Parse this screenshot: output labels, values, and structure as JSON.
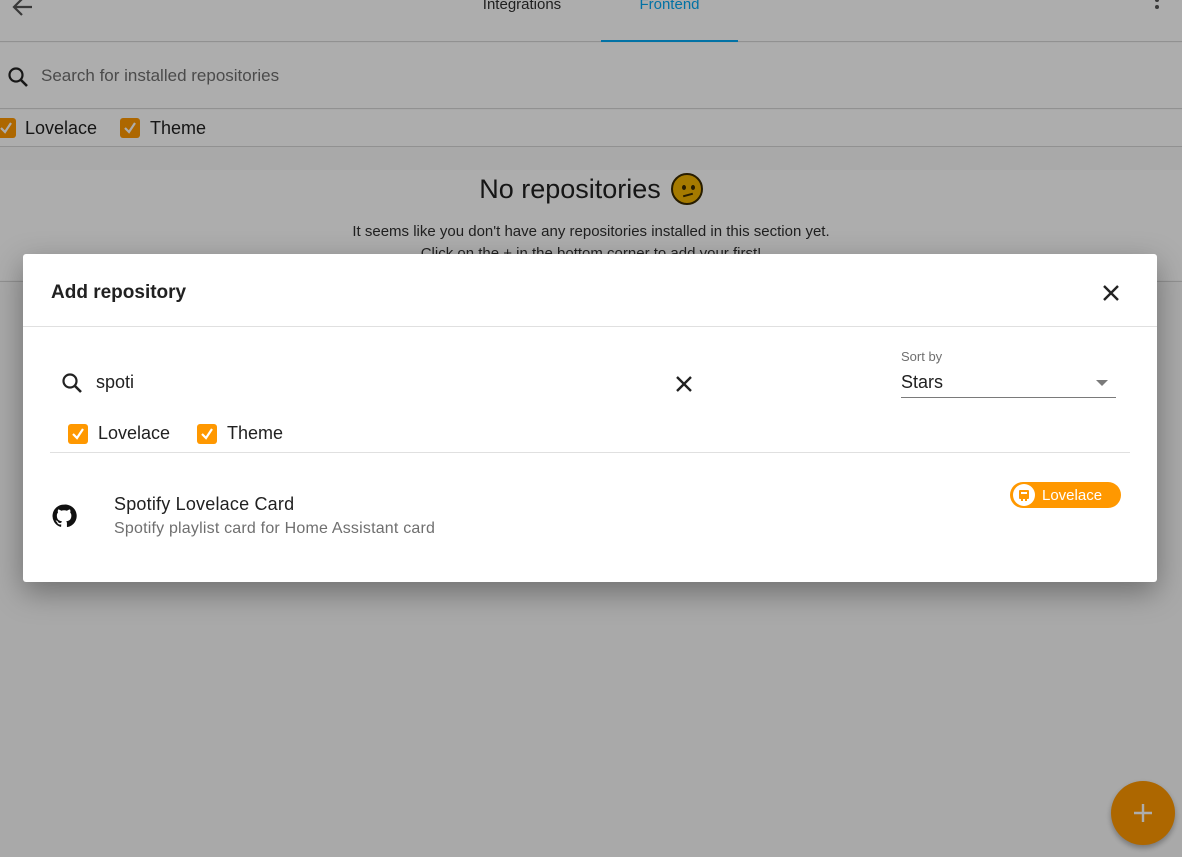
{
  "header": {
    "tabs": [
      {
        "label": "Integrations",
        "active": false
      },
      {
        "label": "Frontend",
        "active": true
      }
    ]
  },
  "search": {
    "placeholder": "Search for installed repositories",
    "value": ""
  },
  "filters": [
    {
      "label": "Lovelace",
      "checked": true
    },
    {
      "label": "Theme",
      "checked": true
    }
  ],
  "empty_state": {
    "title": "No repositories",
    "line1": "It seems like you don't have any repositories installed in this section yet.",
    "line2": "Click on the + in the bottom corner to add your first!"
  },
  "dialog": {
    "title": "Add repository",
    "search_value": "spoti",
    "sort": {
      "label": "Sort by",
      "value": "Stars"
    },
    "filters": [
      {
        "label": "Lovelace",
        "checked": true
      },
      {
        "label": "Theme",
        "checked": true
      }
    ],
    "results": [
      {
        "name": "Spotify Lovelace Card",
        "description": "Spotify playlist card for Home Assistant card",
        "category": "Lovelace",
        "icon": "github-icon"
      }
    ]
  },
  "colors": {
    "accent": "#ff9800",
    "primary": "#03a9f4"
  }
}
